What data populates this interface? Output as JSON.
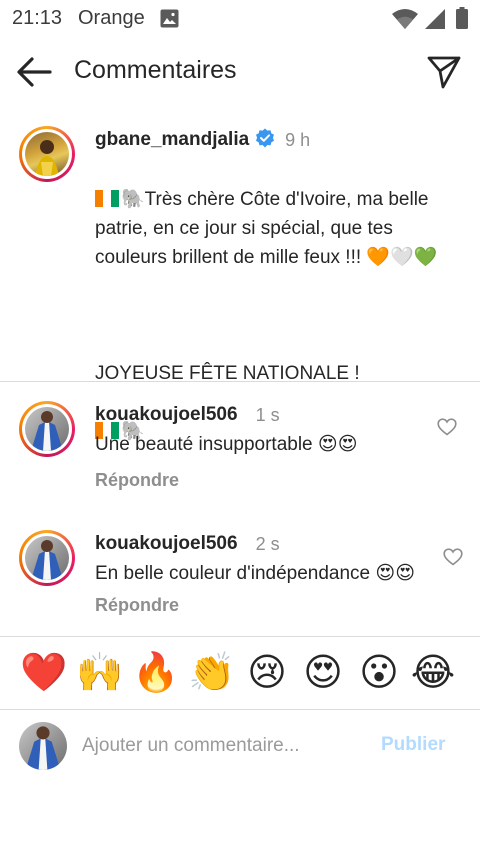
{
  "status_bar": {
    "time": "21:13",
    "carrier": "Orange"
  },
  "header": {
    "title": "Commentaires"
  },
  "caption": {
    "username": "gbane_mandjalia",
    "time": "9 h",
    "line1": "🐘Très chère Côte d'Ivoire, ma belle patrie, en ce jour si spécial, que tes couleurs brillent de mille feux !!! 🧡🤍💚",
    "line2": "JOYEUSE FÊTE NATIONALE !",
    "line3": "🐘"
  },
  "comments": [
    {
      "username": "kouakoujoel506",
      "time": "1 s",
      "text": "Une beauté insupportable 😍😍",
      "reply_label": "Répondre"
    },
    {
      "username": "kouakoujoel506",
      "time": "2 s",
      "text": "En belle couleur d'indépendance 😍😍",
      "reply_label": "Répondre"
    }
  ],
  "emoji_bar": [
    "❤️",
    "🙌",
    "🔥",
    "👏",
    "😢",
    "😍",
    "😮",
    "😂"
  ],
  "composer": {
    "placeholder": "Ajouter un commentaire...",
    "post_label": "Publier"
  },
  "colors": {
    "accent_disabled": "#b3dbff",
    "secondary_text": "#8e8e8e",
    "verified": "#3897f0",
    "flag_orange": "#f77f00",
    "flag_white": "#ffffff",
    "flag_green": "#009e60"
  },
  "icons": [
    "back-arrow-icon",
    "send-icon",
    "verified-badge-icon",
    "heart-outline-icon",
    "wifi-icon",
    "signal-icon",
    "battery-icon",
    "image-icon"
  ]
}
